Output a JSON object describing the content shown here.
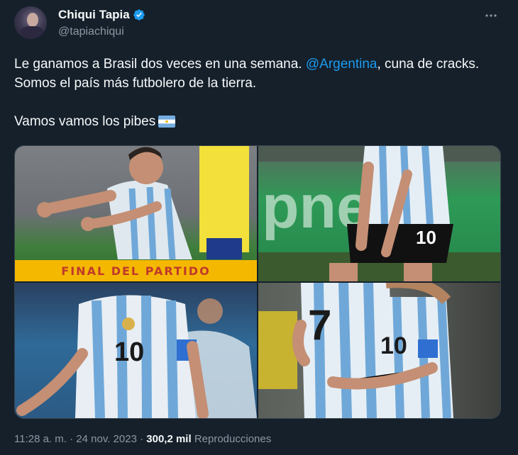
{
  "author": {
    "display_name": "Chiqui Tapia",
    "handle": "@tapiachiqui",
    "verified_icon": "verified-badge-icon"
  },
  "tweet": {
    "text_before_mention": "Le ganamos a Brasil dos veces en una semana. ",
    "mention": "@Argentina",
    "text_after_mention": ", cuna de cracks. Somos el país más futbolero de la tierra.",
    "second_line": "Vamos vamos los pibes",
    "emoji": "argentina-flag-emoji"
  },
  "media": {
    "banner_text": "FINAL DEL PARTIDO",
    "jersey_number_top_right": "10",
    "jersey_number_bottom_left": "10",
    "jersey_number_bottom_right_1": "7",
    "jersey_number_bottom_right_2": "10",
    "ad_board_text": "pne"
  },
  "meta": {
    "time": "11:28 a. m.",
    "separator": "·",
    "date": "24 nov. 2023",
    "views_count": "300,2 mil",
    "views_label": "Reproducciones"
  },
  "colors": {
    "background": "#15202b",
    "link": "#1d9bf0",
    "secondary_text": "#8b98a5",
    "banner": "#f5b800"
  }
}
